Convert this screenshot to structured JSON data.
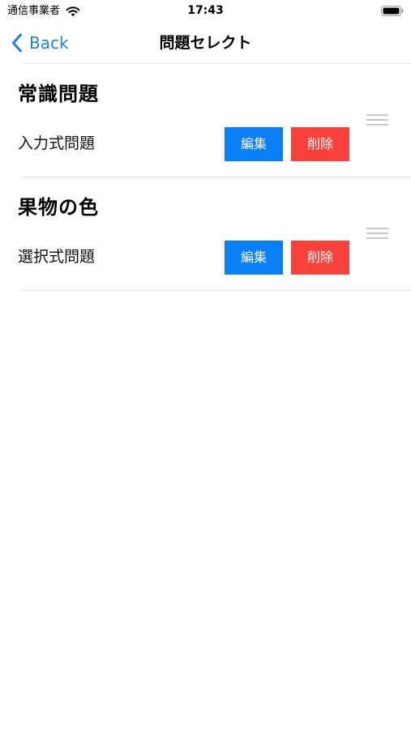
{
  "status_bar": {
    "carrier": "通信事業者",
    "time": "17:43"
  },
  "nav": {
    "back_label": "Back",
    "title": "問題セレクト"
  },
  "items": [
    {
      "title": "常識問題",
      "type": "入力式問題",
      "edit_label": "編集",
      "delete_label": "削除"
    },
    {
      "title": "果物の色",
      "type": "選択式問題",
      "edit_label": "編集",
      "delete_label": "削除"
    }
  ],
  "colors": {
    "accent": "#1a80e6",
    "edit": "#0a7ff7",
    "delete": "#f8413a",
    "separator": "#e4e4e6"
  },
  "icons": {
    "back": "chevron-left-icon",
    "wifi": "wifi-icon",
    "battery": "battery-icon",
    "reorder": "drag-handle-icon"
  }
}
